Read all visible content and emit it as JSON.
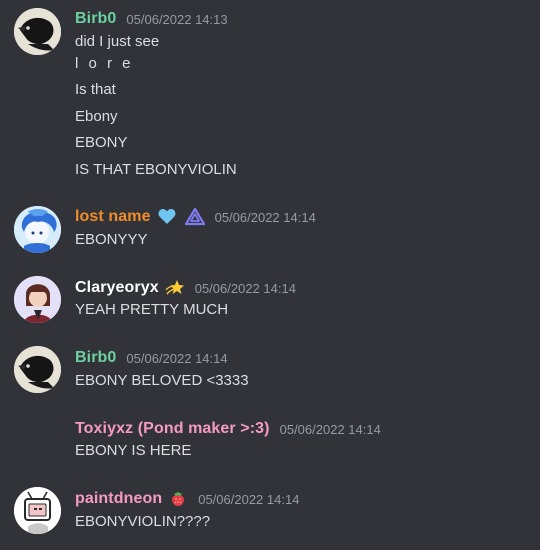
{
  "messages": [
    {
      "username": "Birb0",
      "username_color": "#6ecfa0",
      "timestamp": "05/06/2022 14:13",
      "avatar": "crow-avatar",
      "lines": [
        "did I just see",
        "l o r e",
        "Is that",
        "Ebony",
        "EBONY",
        "IS THAT EBONYVIOLIN"
      ]
    },
    {
      "username": "lost name",
      "username_color": "#f08c2a",
      "timestamp": "05/06/2022 14:14",
      "avatar": "blue-hair-avatar",
      "badges": [
        "blue-heart-icon",
        "triangle-icon"
      ],
      "lines": [
        "EBONYYY"
      ]
    },
    {
      "username": "Claryeoryx",
      "username_color": "#ffffff",
      "timestamp": "05/06/2022 14:14",
      "avatar": "brown-hair-avatar",
      "badges": [
        "dizzy-star-icon"
      ],
      "lines": [
        "YEAH PRETTY MUCH"
      ]
    },
    {
      "username": "Birb0",
      "username_color": "#6ecfa0",
      "timestamp": "05/06/2022 14:14",
      "avatar": "crow-avatar",
      "lines": [
        "EBONY BELOVED <3333"
      ]
    },
    {
      "username": "Toxiyxz (Pond maker >:3)",
      "username_color": "#f59ac5",
      "timestamp": "05/06/2022 14:14",
      "avatar": "none",
      "lines": [
        "EBONY IS HERE"
      ]
    },
    {
      "username": "paintdneon",
      "username_color": "#f59ac5",
      "timestamp": "05/06/2022 14:14",
      "avatar": "tv-head-avatar",
      "badges": [
        "strawberry-icon"
      ],
      "lines": [
        "EBONYVIOLIN????"
      ]
    }
  ]
}
